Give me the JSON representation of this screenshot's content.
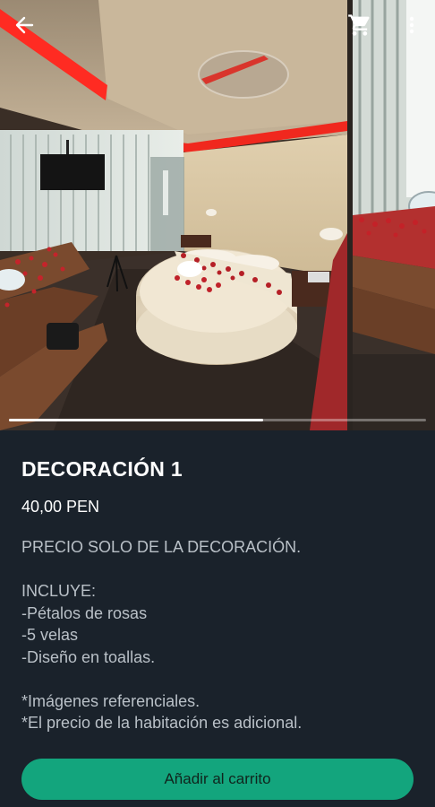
{
  "product": {
    "title": "DECORACIÓN 1",
    "price": "40,00 PEN",
    "description_lines": [
      "PRECIO SOLO DE LA DECORACIÓN.",
      "",
      "INCLUYE:",
      "-Pétalos de rosas",
      "-5 velas",
      "-Diseño en toallas.",
      "",
      "*Imágenes referenciales.",
      "*El precio de la habitación es adicional."
    ]
  },
  "gallery": {
    "progress_fraction": 0.61,
    "images": [
      {
        "icon": "room-photo-round-bed"
      },
      {
        "icon": "room-photo-jacuzzi"
      }
    ]
  },
  "toolbar": {
    "back_icon": "arrow-left-icon",
    "cart_icon": "shopping-cart-icon",
    "more_icon": "more-vertical-icon"
  },
  "footer": {
    "add_to_cart_label": "Añadir al carrito"
  },
  "colors": {
    "background": "#1a222b",
    "accent": "#13a57d",
    "title_text": "#ffffff",
    "body_text": "#b9c0c7"
  }
}
